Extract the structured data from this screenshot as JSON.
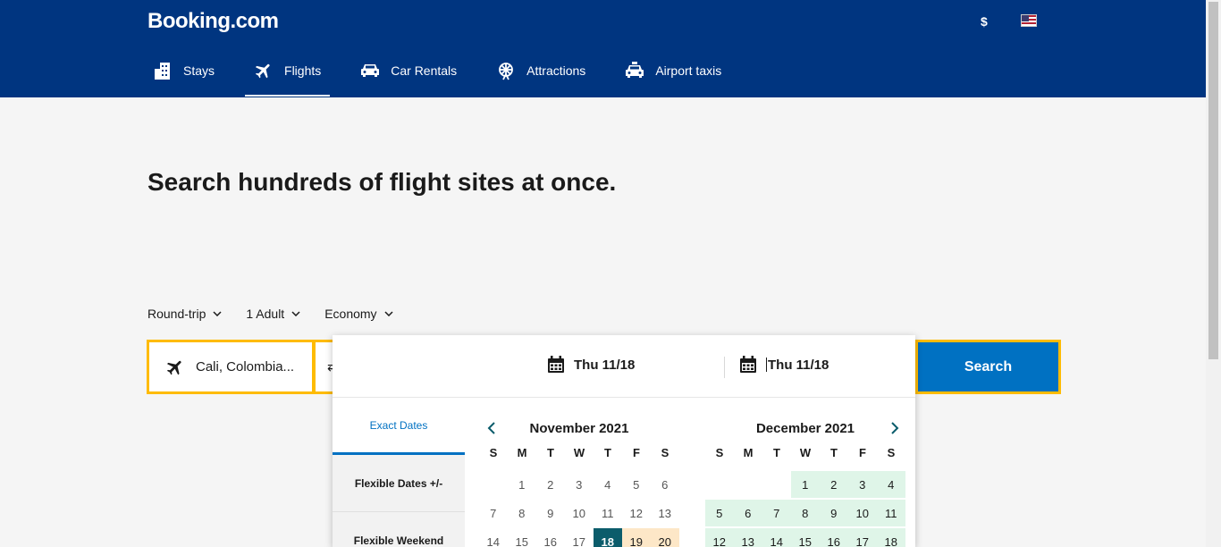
{
  "header": {
    "logo_main": "Booking",
    "logo_suffix": ".com",
    "currency": "$",
    "nav": [
      {
        "label": "Stays",
        "icon": "building-icon"
      },
      {
        "label": "Flights",
        "icon": "plane-icon",
        "active": true
      },
      {
        "label": "Car Rentals",
        "icon": "car-icon"
      },
      {
        "label": "Attractions",
        "icon": "ferris-wheel-icon"
      },
      {
        "label": "Airport taxis",
        "icon": "taxi-icon"
      }
    ]
  },
  "main": {
    "headline": "Search hundreds of flight sites at once.",
    "options": {
      "trip_type": "Round-trip",
      "passengers": "1 Adult",
      "cabin": "Economy"
    },
    "from_value": "Cali, Colombia...",
    "search_label": "Search"
  },
  "datepicker": {
    "depart": "Thu 11/18",
    "return": "Thu 11/18",
    "tabs": [
      "Exact Dates",
      "Flexible Dates +/-",
      "Flexible Weekend"
    ],
    "weekdays": [
      "S",
      "M",
      "T",
      "W",
      "T",
      "F",
      "S"
    ],
    "months": [
      {
        "title": "November 2021",
        "rows": [
          [
            "",
            "1",
            "2",
            "3",
            "4",
            "5",
            "6"
          ],
          [
            "7",
            "8",
            "9",
            "10",
            "11",
            "12",
            "13"
          ],
          [
            "14",
            "15",
            "16",
            "17",
            "18",
            "19",
            "20"
          ]
        ]
      },
      {
        "title": "December 2021",
        "rows": [
          [
            "",
            "",
            "",
            "1",
            "2",
            "3",
            "4"
          ],
          [
            "5",
            "6",
            "7",
            "8",
            "9",
            "10",
            "11"
          ],
          [
            "12",
            "13",
            "14",
            "15",
            "16",
            "17",
            "18"
          ]
        ]
      }
    ]
  },
  "colors": {
    "brand_blue": "#003580",
    "accent_blue": "#0071c2",
    "highlight_yellow": "#febb02",
    "selected_day": "#0b5c6b",
    "available_green": "#dff5e8",
    "weekend_orange": "#fde7c7"
  }
}
